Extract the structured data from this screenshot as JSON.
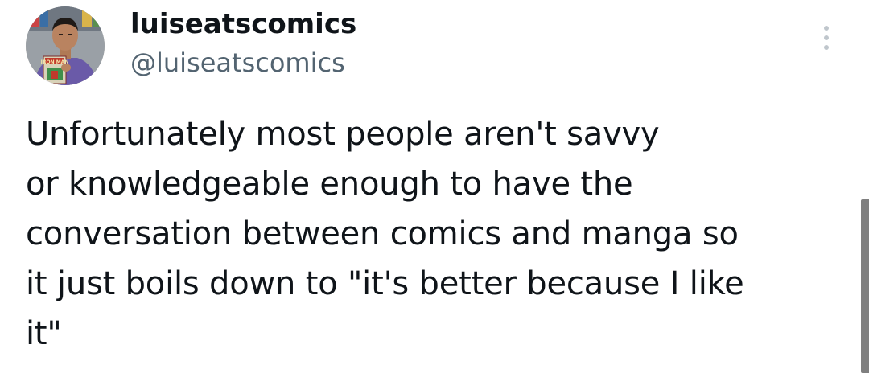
{
  "tweet": {
    "display_name": "luiseatscomics",
    "handle": "@luiseatscomics",
    "more_icon": "more-vertical-icon",
    "avatar_caption": "IRON MAN",
    "text_lines": [
      "Unfortunately most people aren't savvy",
      "or knowledgeable enough to have the",
      "conversation between comics and manga so",
      "it just boils down to \"it's better because I like",
      "it\""
    ]
  },
  "colors": {
    "text_primary": "#0f1419",
    "text_secondary": "#536471",
    "scrollbar": "#7f7f7f"
  }
}
